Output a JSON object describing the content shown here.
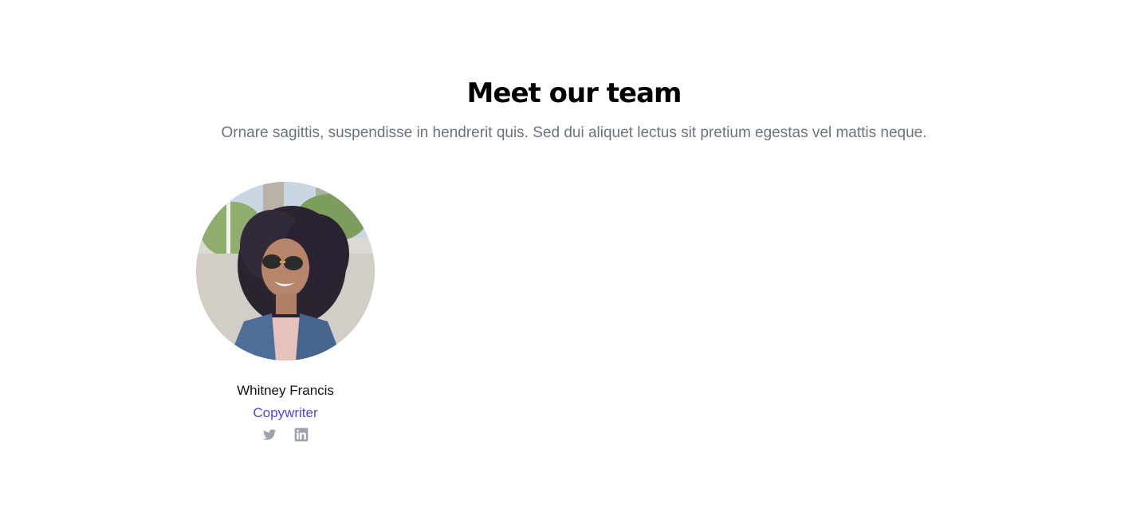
{
  "header": {
    "title": "Meet our team",
    "subtitle": "Ornare sagittis, suspendisse in hendrerit quis. Sed dui aliquet lectus sit pretium egestas vel mattis neque."
  },
  "team": [
    {
      "name": "Whitney Francis",
      "role": "Copywriter",
      "socials": [
        {
          "icon": "twitter-icon"
        },
        {
          "icon": "linkedin-icon"
        }
      ]
    }
  ],
  "colors": {
    "accent": "#4f46e5",
    "muted_text": "#6b7280",
    "icon": "#9ca3af"
  }
}
